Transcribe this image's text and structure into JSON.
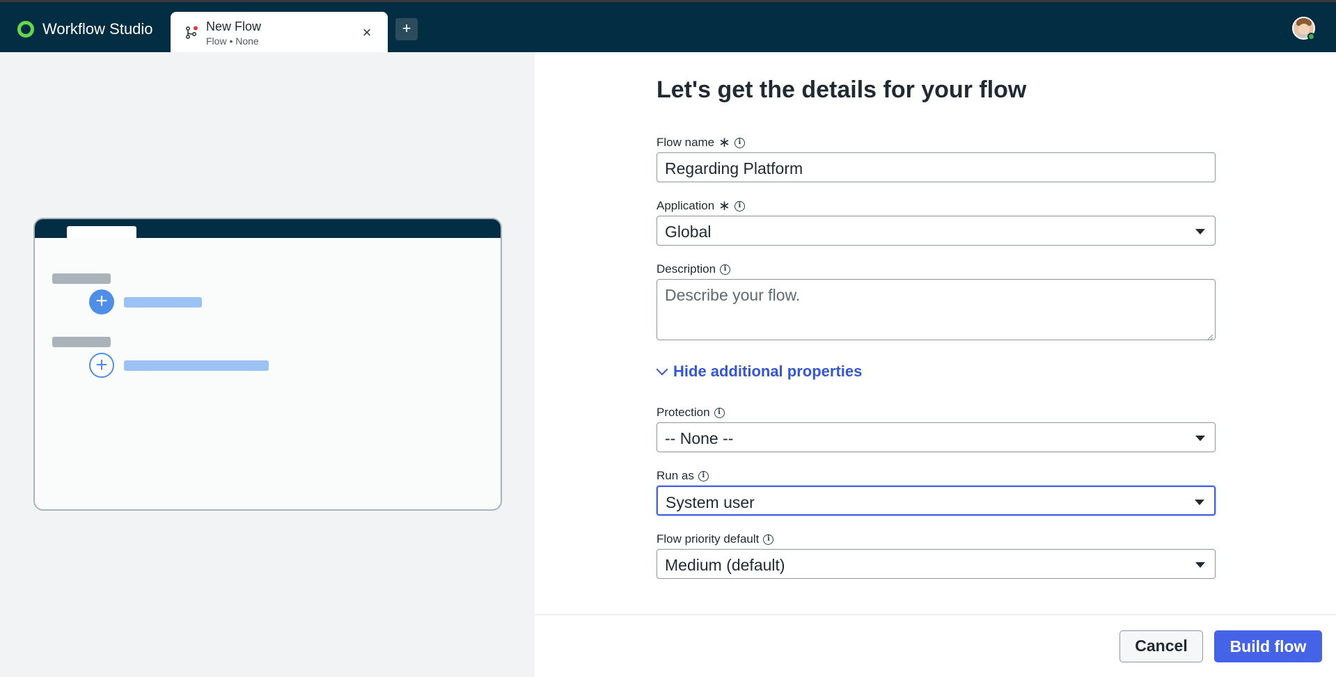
{
  "app": {
    "name": "Workflow Studio"
  },
  "tab": {
    "title": "New Flow",
    "subtitle": "Flow • None",
    "close_icon": "×",
    "new_tab_icon": "+"
  },
  "form": {
    "title": "Let's get the details for your flow",
    "flow_name": {
      "label": "Flow name",
      "value": "Regarding Platform",
      "required": true
    },
    "application": {
      "label": "Application",
      "value": "Global",
      "required": true
    },
    "description": {
      "label": "Description",
      "placeholder": "Describe your flow."
    },
    "toggle_label": "Hide additional properties",
    "protection": {
      "label": "Protection",
      "value": "-- None --"
    },
    "run_as": {
      "label": "Run as",
      "value": "System user"
    },
    "flow_priority": {
      "label": "Flow priority default",
      "value": "Medium (default)"
    }
  },
  "footer": {
    "cancel_label": "Cancel",
    "build_label": "Build flow"
  },
  "colors": {
    "header": "#032d42",
    "accent": "#4563e6",
    "link": "#3456d8",
    "brand_green": "#62d84e"
  },
  "icons": {
    "required": "required-asterisk-icon",
    "info": "info-icon",
    "dropdown": "caret-down-icon"
  }
}
